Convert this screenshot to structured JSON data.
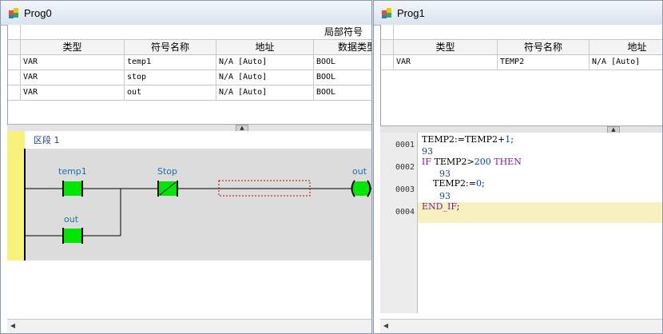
{
  "prog0": {
    "title": "Prog0",
    "group_header": "局部符号",
    "columns": [
      "类型",
      "符号名称",
      "地址",
      "数据类型"
    ],
    "rows": [
      {
        "type": "VAR",
        "name": "temp1",
        "address": "N/A [Auto]",
        "datatype": "BOOL"
      },
      {
        "type": "VAR",
        "name": "stop",
        "address": "N/A [Auto]",
        "datatype": "BOOL"
      },
      {
        "type": "VAR",
        "name": "out",
        "address": "N/A [Auto]",
        "datatype": "BOOL"
      }
    ],
    "network_label": "区段 1",
    "contacts": {
      "temp1": "temp1",
      "stop": "Stop",
      "out_contact": "out",
      "coil": "out"
    }
  },
  "prog1": {
    "title": "Prog1",
    "columns": [
      "类型",
      "符号名称",
      "地址"
    ],
    "rows": [
      {
        "type": "VAR",
        "name": "TEMP2",
        "address": "N/A [Auto]"
      }
    ],
    "line_numbers": [
      "0001",
      "0002",
      "0003",
      "0004"
    ],
    "code": {
      "l1_a": "TEMP2:=TEMP2+",
      "l1_b": "1",
      "l1_c": ";",
      "l2_kw1": "IF",
      "l2_a": " TEMP2>",
      "l2_b": "200",
      "l2_kw2": " THEN",
      "l3_a": "    TEMP2:=",
      "l3_b": "0",
      "l3_c": ";",
      "l4_a": "END_IF",
      "l4_b": ";"
    },
    "monitor_values": [
      "93",
      "93",
      "93"
    ]
  },
  "colors": {
    "contact_on": "#00e600",
    "rail": "#f7f37a",
    "keyword": "#7b1fa2"
  }
}
